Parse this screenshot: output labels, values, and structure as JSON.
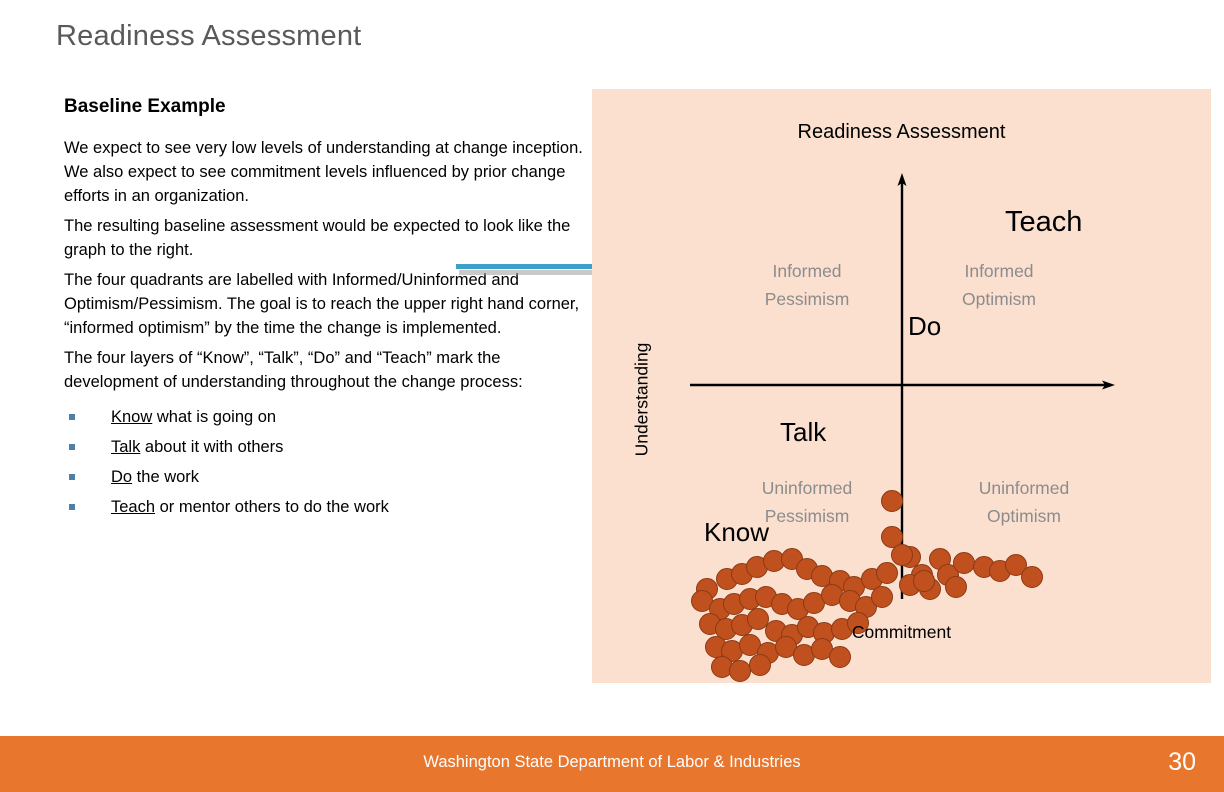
{
  "slide": {
    "title": "Readiness Assessment",
    "title_color": "#595959"
  },
  "left": {
    "heading": "Baseline Example",
    "paragraphs": [
      "We expect to see very low levels of understanding at change inception. We also expect to see commitment levels influenced by prior change efforts in an organization.",
      "The resulting baseline assessment would be expected to look like the graph to the right.",
      "The four quadrants are labelled with Informed/Uninformed and Optimism/Pessimism. The goal is to reach the upper right hand corner, “informed optimism” by the time the change is implemented.",
      "The four layers of “Know”, “Talk”, “Do” and “Teach” mark the development of understanding throughout the change process:"
    ],
    "bullets": [
      {
        "lead": "Know",
        "rest": " what is going on"
      },
      {
        "lead": "Talk",
        "rest": " about it with others"
      },
      {
        "lead": "Do",
        "rest": " the work"
      },
      {
        "lead": "Teach",
        "rest": " or mentor others to do the work"
      }
    ],
    "bullet_marker_color": "#4F81A8",
    "arrow_color": "#3E9FCB"
  },
  "chart_data": {
    "type": "scatter",
    "title": "Readiness Assessment",
    "xlabel": "Commitment",
    "ylabel": "Understanding",
    "panel_color": "#FBE0D0",
    "point_color": "#C0501E",
    "point_border_color": "#8A3A15",
    "grid": false,
    "legend": false,
    "xlim": [
      0,
      100
    ],
    "ylim": [
      0,
      100
    ],
    "axis_origin": [
      50,
      50
    ],
    "quadrant_labels": [
      {
        "name": "informed-pessimism",
        "line1": "Informed",
        "line2": "Pessimism",
        "quadrant": "upper-left"
      },
      {
        "name": "informed-optimism",
        "line1": "Informed",
        "line2": "Optimism",
        "quadrant": "upper-right"
      },
      {
        "name": "uninformed-pessimism",
        "line1": "Uninformed",
        "line2": "Pessimism",
        "quadrant": "lower-left"
      },
      {
        "name": "uninformed-optimism",
        "line1": "Uninformed",
        "line2": "Optimism",
        "quadrant": "lower-right"
      }
    ],
    "layer_labels": [
      {
        "name": "teach",
        "label": "Teach",
        "x": 1013,
        "y": 215
      },
      {
        "name": "do",
        "label": "Do",
        "x": 910,
        "y": 322
      },
      {
        "name": "talk",
        "label": "Talk",
        "x": 782,
        "y": 428
      },
      {
        "name": "know",
        "label": "Know",
        "x": 706,
        "y": 530
      }
    ],
    "points": [
      [
        115,
        500
      ],
      [
        135,
        490
      ],
      [
        150,
        485
      ],
      [
        165,
        478
      ],
      [
        182,
        472
      ],
      [
        200,
        470
      ],
      [
        215,
        480
      ],
      [
        230,
        487
      ],
      [
        248,
        492
      ],
      [
        262,
        498
      ],
      [
        280,
        490
      ],
      [
        295,
        484
      ],
      [
        110,
        512
      ],
      [
        128,
        520
      ],
      [
        142,
        515
      ],
      [
        158,
        510
      ],
      [
        174,
        508
      ],
      [
        190,
        515
      ],
      [
        206,
        520
      ],
      [
        222,
        514
      ],
      [
        240,
        506
      ],
      [
        258,
        512
      ],
      [
        274,
        518
      ],
      [
        290,
        508
      ],
      [
        118,
        535
      ],
      [
        134,
        540
      ],
      [
        150,
        536
      ],
      [
        166,
        530
      ],
      [
        184,
        542
      ],
      [
        200,
        546
      ],
      [
        216,
        538
      ],
      [
        232,
        544
      ],
      [
        250,
        540
      ],
      [
        266,
        534
      ],
      [
        124,
        558
      ],
      [
        140,
        562
      ],
      [
        158,
        556
      ],
      [
        176,
        564
      ],
      [
        194,
        558
      ],
      [
        212,
        566
      ],
      [
        230,
        560
      ],
      [
        248,
        568
      ],
      [
        130,
        578
      ],
      [
        148,
        582
      ],
      [
        168,
        576
      ],
      [
        300,
        412
      ],
      [
        300,
        448
      ],
      [
        318,
        468
      ],
      [
        330,
        486
      ],
      [
        338,
        500
      ],
      [
        348,
        470
      ],
      [
        356,
        486
      ],
      [
        364,
        498
      ],
      [
        372,
        474
      ],
      [
        318,
        496
      ],
      [
        332,
        492
      ],
      [
        392,
        478
      ],
      [
        408,
        482
      ],
      [
        424,
        476
      ],
      [
        440,
        488
      ],
      [
        310,
        466
      ]
    ]
  },
  "footer": {
    "text": "Washington State Department of Labor & Industries",
    "page_number": "30",
    "bar_color": "#E8762C"
  }
}
